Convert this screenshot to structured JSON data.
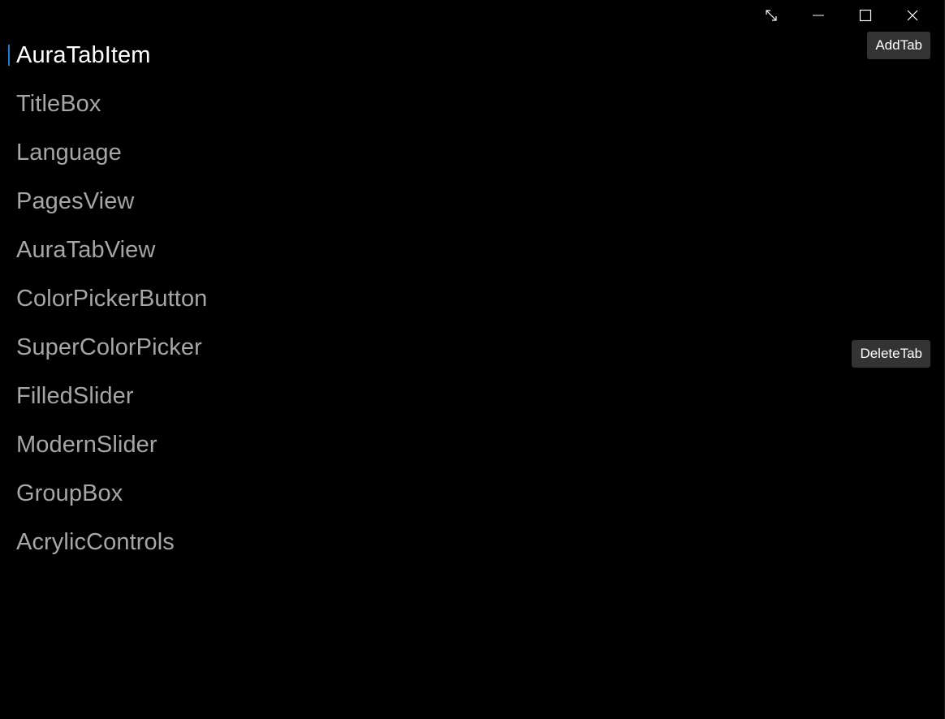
{
  "window": {
    "caption_buttons": [
      {
        "name": "fullscreen",
        "icon": "expand-diagonal-icon"
      },
      {
        "name": "minimize",
        "icon": "minimize-icon"
      },
      {
        "name": "maximize",
        "icon": "maximize-icon"
      },
      {
        "name": "close",
        "icon": "close-icon"
      }
    ],
    "accent_color": "#1f7ad3"
  },
  "nav": {
    "selected_index": 0,
    "items": [
      {
        "label": "AuraTabItem"
      },
      {
        "label": "TitleBox"
      },
      {
        "label": "Language"
      },
      {
        "label": "PagesView"
      },
      {
        "label": "AuraTabView"
      },
      {
        "label": "ColorPickerButton"
      },
      {
        "label": "SuperColorPicker"
      },
      {
        "label": "FilledSlider"
      },
      {
        "label": "ModernSlider"
      },
      {
        "label": "GroupBox"
      },
      {
        "label": "AcrylicControls"
      }
    ]
  },
  "actions": {
    "add_tab_label": "AddTab",
    "delete_tab_label": "DeleteTab"
  }
}
